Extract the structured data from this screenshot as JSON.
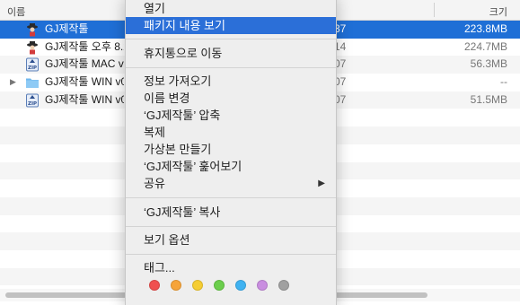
{
  "header": {
    "name_col": "이름",
    "size_col": "크기"
  },
  "files": [
    {
      "name": "GJ제작툴",
      "date": "37",
      "size": "223.8MB",
      "icon": "app-icon",
      "selected": true
    },
    {
      "name": "GJ제작툴 오후 8.2",
      "date": "14",
      "size": "224.7MB",
      "icon": "app-icon"
    },
    {
      "name": "GJ제작툴 MAC v0",
      "date": "07",
      "size": "56.3MB",
      "icon": "zip-icon"
    },
    {
      "name": "GJ제작툴 WIN v0",
      "date": "07",
      "size": "--",
      "icon": "folder-icon",
      "expandable": true
    },
    {
      "name": "GJ제작툴 WIN v0",
      "date": "07",
      "size": "51.5MB",
      "icon": "zip-icon"
    }
  ],
  "menu": {
    "open": "열기",
    "show_package": "패키지 내용 보기",
    "move_trash": "휴지통으로 이동",
    "get_info": "정보 가져오기",
    "rename": "이름 변경",
    "compress": "‘GJ제작툴’ 압축",
    "duplicate": "복제",
    "make_alias": "가상본 만들기",
    "quick_look": "‘GJ제작툴’ 훑어보기",
    "share": "공유",
    "copy": "‘GJ제작툴’ 복사",
    "view_options": "보기 옵션",
    "tags": "태그..."
  },
  "tag_colors": [
    "#f0504f",
    "#f6a43a",
    "#f5cd33",
    "#6bce4c",
    "#3fb2f1",
    "#c98ee0",
    "#a0a0a0"
  ],
  "colors": {
    "selection": "#1f6fd6",
    "menu_highlight": "#2b6fd8"
  }
}
